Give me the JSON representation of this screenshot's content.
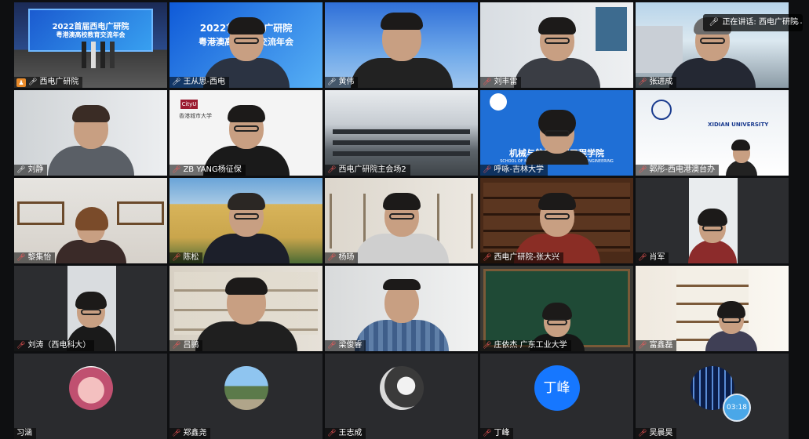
{
  "speaker_indicator": {
    "label": "正在讲话: 西电广研院"
  },
  "timer": "03:18",
  "banners": {
    "top_line": "2022首届西电广研院",
    "sub_line": "粤港澳高校教育交流年会",
    "jilin_school": "机械与航空航天工程学院",
    "jilin_school_en": "SCHOOL OF MECHANICAL AND AEROSPACE ENGINEERING",
    "xidian_en": "XIDIAN UNIVERSITY",
    "cityu": "CityU",
    "cityu_text": "香港城市大学"
  },
  "tiles": [
    {
      "name": "西电广研院",
      "icon": "host"
    },
    {
      "name": "王从思-西电",
      "icon": "mic"
    },
    {
      "name": "黄伟",
      "icon": "mic"
    },
    {
      "name": "刘丰雷",
      "icon": "mic"
    },
    {
      "name": "张进成",
      "icon": "mic"
    },
    {
      "name": "刘静",
      "icon": "mic"
    },
    {
      "name": "ZB YANG杨征保",
      "icon": "mute"
    },
    {
      "name": "西电广研院主会场2",
      "icon": "mute"
    },
    {
      "name": "呼咏-吉林大学",
      "icon": "mute"
    },
    {
      "name": "郭彤-西电港澳台办",
      "icon": "mute"
    },
    {
      "name": "黎集怡",
      "icon": "mute"
    },
    {
      "name": "陈松",
      "icon": "mute"
    },
    {
      "name": "杨旸",
      "icon": "mute"
    },
    {
      "name": "西电广研院-张大兴",
      "icon": "mute"
    },
    {
      "name": "肖军",
      "icon": "mute"
    },
    {
      "name": "刘涛（西电科大）",
      "icon": "mute"
    },
    {
      "name": "吕鹏",
      "icon": "mute"
    },
    {
      "name": "梁俊睿",
      "icon": "mute"
    },
    {
      "name": "庄依杰 广东工业大学",
      "icon": "mute"
    },
    {
      "name": "富鑫磊",
      "icon": "mute"
    },
    {
      "name": "习涵",
      "icon": "none"
    },
    {
      "name": "郑鑫尧",
      "icon": "mute"
    },
    {
      "name": "王志成",
      "icon": "mute"
    },
    {
      "name": "丁峰",
      "icon": "mute"
    },
    {
      "name": "吴晨昊",
      "icon": "mute"
    }
  ],
  "avatar_initial": "丁峰"
}
